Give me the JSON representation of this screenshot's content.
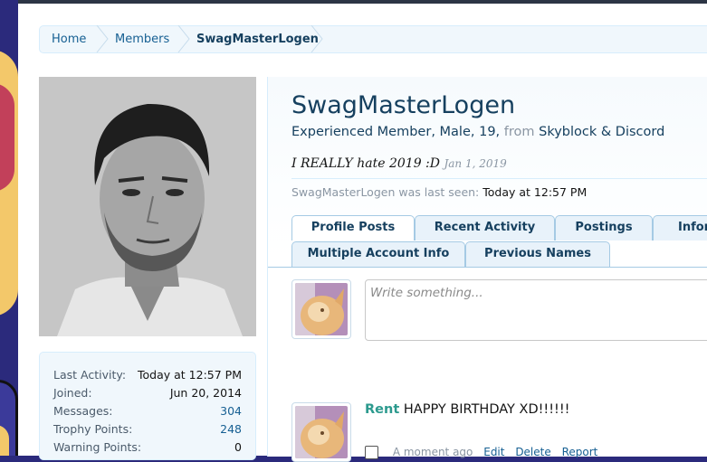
{
  "breadcrumb": [
    "Home",
    "Members",
    "SwagMasterLogen"
  ],
  "profile": {
    "username": "SwagMasterLogen",
    "blurb_prefix": "Experienced Member, Male, 19,",
    "blurb_from": "from",
    "blurb_location": "Skyblock & Discord",
    "status_text": "I REALLY hate 2019 :D",
    "status_date": "Jan 1, 2019",
    "last_seen_label": "SwagMasterLogen was last seen:",
    "last_seen_value": "Today at 12:57 PM"
  },
  "stats": [
    {
      "label": "Last Activity:",
      "value": "Today at 12:57 PM"
    },
    {
      "label": "Joined:",
      "value": "Jun 20, 2014"
    },
    {
      "label": "Messages:",
      "value": "304"
    },
    {
      "label": "Trophy Points:",
      "value": "248"
    },
    {
      "label": "Warning Points:",
      "value": "0"
    }
  ],
  "tabs_row1": [
    "Profile Posts",
    "Recent Activity",
    "Postings",
    "Information"
  ],
  "tabs_row2": [
    "Multiple Account Info",
    "Previous Names"
  ],
  "compose": {
    "placeholder": "Write something..."
  },
  "post": {
    "author": "Rent",
    "message": "HAPPY BIRTHDAY XD!!!!!!",
    "time": "A moment ago",
    "actions": [
      "Edit",
      "Delete",
      "Report"
    ]
  },
  "colors": {
    "accent": "#16405f",
    "link": "#176093",
    "author": "#2c9a8e",
    "tab_border": "#a5cae4"
  }
}
